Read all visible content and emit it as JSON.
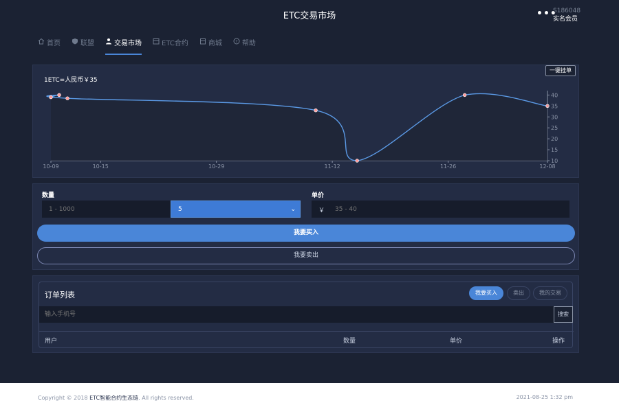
{
  "app": {
    "title": "ETC交易市场"
  },
  "user": {
    "id": "S186048",
    "role": "实名会员"
  },
  "nav": [
    {
      "label": "首页",
      "icon": "home-icon"
    },
    {
      "label": "联盟",
      "icon": "shield-icon"
    },
    {
      "label": "交易市场",
      "icon": "user-icon",
      "active": true
    },
    {
      "label": "ETC合约",
      "icon": "calendar-icon"
    },
    {
      "label": "商城",
      "icon": "shop-icon"
    },
    {
      "label": "帮助",
      "icon": "help-icon"
    }
  ],
  "market": {
    "price_label": "1ETC=人民币￥35",
    "quick_order_label": "一键挂单"
  },
  "chart_data": {
    "type": "line",
    "x": [
      "10-09",
      "10-10",
      "10-11",
      "11-10",
      "11-15",
      "11-28",
      "12-08"
    ],
    "values": [
      39,
      40,
      38.5,
      33,
      10,
      40,
      35
    ],
    "x_ticks": [
      "10-09",
      "10-15",
      "10-29",
      "11-12",
      "11-26",
      "12-08"
    ],
    "y_ticks": [
      10,
      15,
      20,
      25,
      30,
      35,
      40
    ],
    "ylim": [
      10,
      42
    ],
    "y_axis_side": "right",
    "line_color": "#5b9ae6",
    "point_color": "#ff9a9a"
  },
  "form": {
    "quantity_label": "数量",
    "quantity_placeholder": "1 - 1000",
    "quantity_selected": "5",
    "price_label": "单价",
    "currency_symbol": "￥",
    "price_placeholder": "35 - 40",
    "buy_label": "我要买入",
    "sell_label": "我要卖出"
  },
  "orders": {
    "title": "订单列表",
    "tabs": [
      {
        "label": "我要买入",
        "active": true
      },
      {
        "label": "卖出",
        "active": false
      },
      {
        "label": "我的交易",
        "active": false
      }
    ],
    "search_placeholder": "输入手机号",
    "search_label": "搜索",
    "columns": [
      "用户",
      "数量",
      "单价",
      "操作"
    ]
  },
  "footer": {
    "copyright_prefix": "Copyright © 2018 ",
    "copyright_brand": "ETC智能合约生态链",
    "copyright_suffix": ". All rights reserved.",
    "timestamp": "2021-08-25 1:32 pm"
  }
}
